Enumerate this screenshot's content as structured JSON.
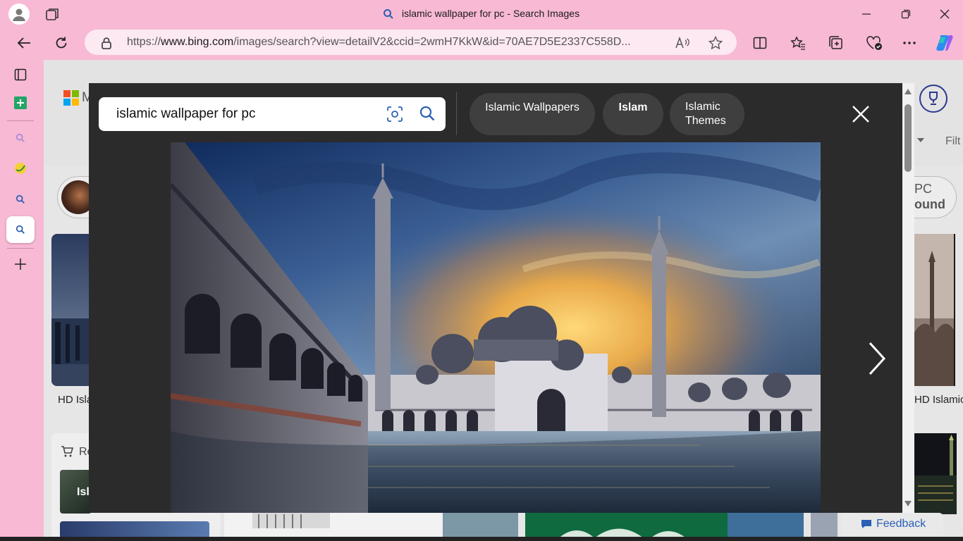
{
  "window": {
    "title": "islamic wallpaper for pc - Search Images"
  },
  "address_bar": {
    "url_prefix": "https://",
    "url_domain": "www.bing.com",
    "url_path": "/images/search?view=detailV2&ccid=2wmH7KkW&id=70AE7D5E2337C558D..."
  },
  "page": {
    "logo_letter": "M",
    "filter_label": "Filt",
    "suggestion_right_line1": "PC",
    "suggestion_right_line2": "ound",
    "caption_left": "HD Isla",
    "caption_right": "HD Islamic",
    "related_left": "Re",
    "card_left_label": "Isl",
    "feedback_label": "Feedback"
  },
  "modal": {
    "search_query": "islamic wallpaper for pc",
    "chips": [
      {
        "label": "Islamic Wallpapers",
        "bold": false
      },
      {
        "label": "Islam",
        "bold": true
      },
      {
        "label": "Islamic Themes",
        "bold": true
      }
    ]
  },
  "colors": {
    "browser_chrome": "#f8b9d4",
    "modal_bg": "#2b2b2b",
    "chip_bg": "#3f3f3f",
    "accent_blue": "#2b5fb4"
  }
}
